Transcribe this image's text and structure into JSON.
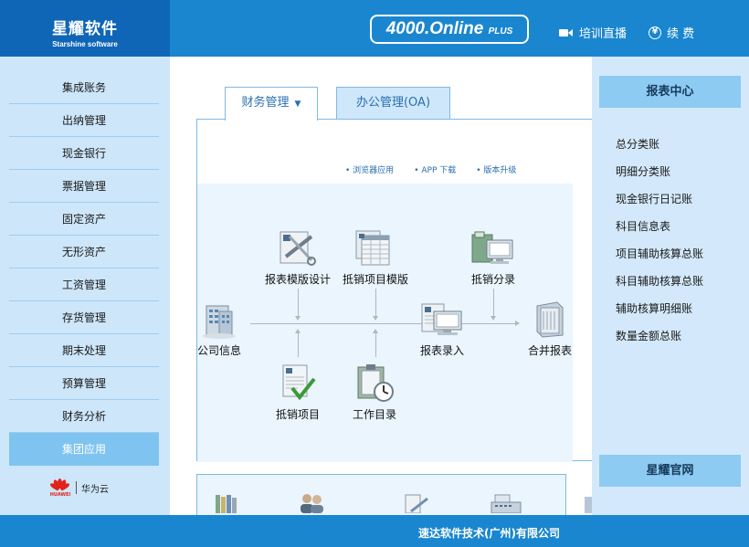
{
  "brand": {
    "name_cn": "星耀软件",
    "name_en": "Starshine software"
  },
  "header": {
    "online_main": "4000.Online",
    "online_plus": "PLUS",
    "live_label": "培训直播",
    "renew_label": "续 费",
    "renew_icon_glyph": "¥"
  },
  "sidebar": {
    "items": [
      {
        "label": "集成账务"
      },
      {
        "label": "出纳管理"
      },
      {
        "label": "现金银行"
      },
      {
        "label": "票据管理"
      },
      {
        "label": "固定资产"
      },
      {
        "label": "无形资产"
      },
      {
        "label": "工资管理"
      },
      {
        "label": "存货管理"
      },
      {
        "label": "期末处理"
      },
      {
        "label": "预算管理"
      },
      {
        "label": "财务分析"
      },
      {
        "label": "集团应用",
        "active": true
      }
    ],
    "partner_label": "华为云",
    "partner_logo_text": "HUAWEI"
  },
  "tabs": {
    "finance": "财务管理",
    "finance_arrow": "▼",
    "office": "办公管理(OA)"
  },
  "sublinks": {
    "browser": "浏览器应用",
    "app": "APP 下载",
    "upgrade": "版本升级"
  },
  "flow": {
    "company_info": "公司信息",
    "report_template": "报表模版设计",
    "expense_template": "抵销项目模版",
    "expense_entry": "抵销分录",
    "report_input": "报表录入",
    "merged_report": "合并报表",
    "expense_item": "抵销项目",
    "work_dir": "工作目录"
  },
  "rsidebar": {
    "title": "报表中心",
    "links": [
      "总分类账",
      "明细分类账",
      "现金银行日记账",
      "科目信息表",
      "项目辅助核算总账",
      "科目辅助核算总账",
      "辅助核算明细账",
      "数量金额总账"
    ],
    "bottom": "星耀官网"
  },
  "footer": {
    "company": "速达软件技术(广州)有限公司"
  },
  "colors": {
    "header_blue": "#1a86cf",
    "brand_blue": "#0f66b7",
    "sidebar_bg": "#cde6fa",
    "active_item": "#7fc4f0"
  }
}
